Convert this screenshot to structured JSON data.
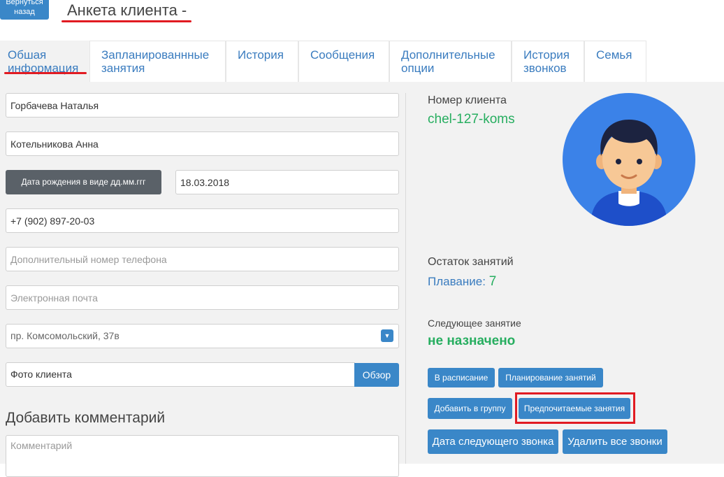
{
  "header": {
    "back_label": "Вернуться назад",
    "title": "Анкета клиента -"
  },
  "tabs": [
    {
      "label": "Обшая информация"
    },
    {
      "label": "Запланированнные занятия"
    },
    {
      "label": "История"
    },
    {
      "label": "Сообщения"
    },
    {
      "label": "Дополнительные опции"
    },
    {
      "label": "История звонков"
    },
    {
      "label": "Семья"
    }
  ],
  "form": {
    "full_name": "Горбачева Наталья",
    "parent_name": "Котельникова Анна",
    "dob_label": "Дата рождения в виде дд.мм.ггг",
    "dob_value": "18.03.2018",
    "phone": "+7 (902) 897-20-03",
    "extra_phone_placeholder": "Дополнительный номер телефона",
    "email_placeholder": "Электронная почта",
    "address": "пр. Комсомольский, 37в",
    "photo_label": "Фото клиента",
    "browse_label": "Обзор",
    "comment_heading": "Добавить комментарий",
    "comment_placeholder": "Комментарий"
  },
  "client": {
    "number_label": "Номер клиента",
    "number_value": "chel-127-koms",
    "remaining_label": "Остаток занятий",
    "remaining_activity": "Плавание:",
    "remaining_count": "7",
    "next_label": "Следующее занятие",
    "next_value": "не назначено"
  },
  "actions": {
    "schedule": "В расписание",
    "planning": "Планирование занятий",
    "add_group": "Добавить в группу",
    "preferred": "Предпочитаемые занятия",
    "next_call_date": "Дата следующего звонка",
    "delete_calls": "Удалить все звонки"
  },
  "colors": {
    "accent_blue": "#3a87c8",
    "green": "#27ae60",
    "highlight_red": "#e11b22",
    "avatar_bg": "#3b82e8"
  }
}
